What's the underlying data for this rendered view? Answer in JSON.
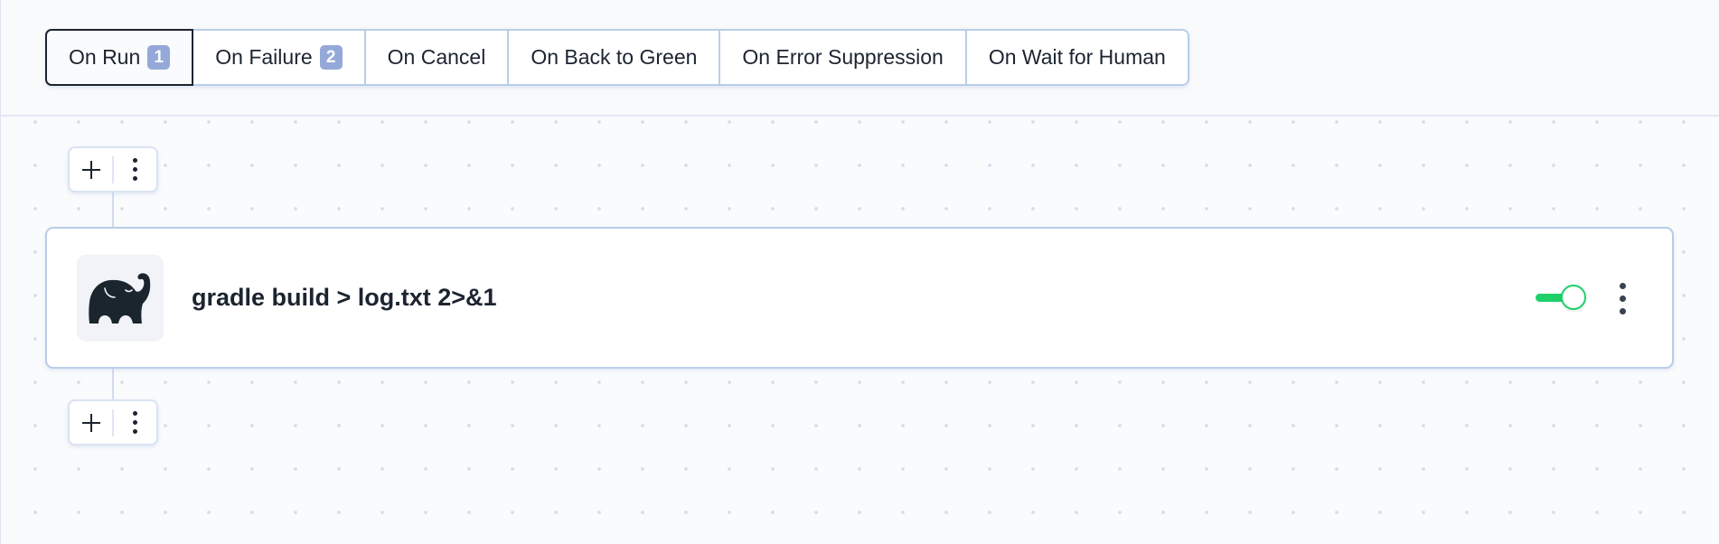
{
  "tabs": [
    {
      "label": "On Run",
      "badge": "1",
      "active": true
    },
    {
      "label": "On Failure",
      "badge": "2",
      "active": false
    },
    {
      "label": "On Cancel",
      "badge": null,
      "active": false
    },
    {
      "label": "On Back to Green",
      "badge": null,
      "active": false
    },
    {
      "label": "On Error Suppression",
      "badge": null,
      "active": false
    },
    {
      "label": "On Wait for Human",
      "badge": null,
      "active": false
    }
  ],
  "steps": [
    {
      "icon": "gradle-elephant-icon",
      "title": "gradle build > log.txt 2>&1",
      "enabled": true
    }
  ],
  "colors": {
    "accent_green": "#1fd06a",
    "badge_bg": "#94a9d8",
    "border_blue": "#b9cde9",
    "text_dark": "#1c2430"
  }
}
